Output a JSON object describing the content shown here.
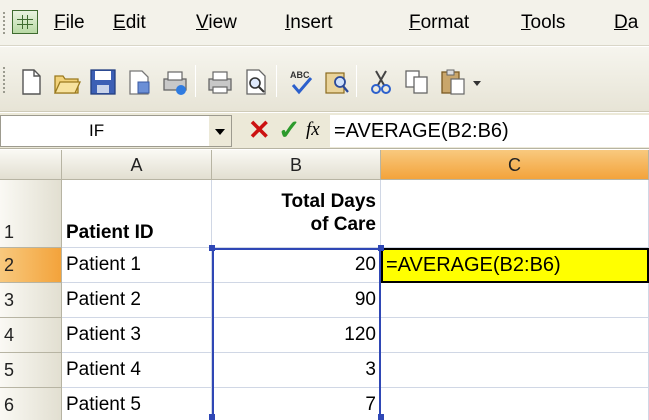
{
  "menubar": {
    "items": [
      "File",
      "Edit",
      "View",
      "Insert",
      "Format",
      "Tools",
      "Da"
    ]
  },
  "toolbar": {
    "buttons": [
      "new-icon",
      "open-icon",
      "save-icon",
      "permission-icon",
      "print-icon",
      "print-preview-icon",
      "spelling-icon",
      "research-icon",
      "cut-icon",
      "copy-icon",
      "paste-icon"
    ]
  },
  "formula_bar": {
    "name_box": "IF",
    "cancel_glyph": "✕",
    "enter_glyph": "✓",
    "fx_label": "fx",
    "formula": "=AVERAGE(B2:B6)"
  },
  "sheet": {
    "columns": [
      "A",
      "B",
      "C"
    ],
    "rows": [
      "1",
      "2",
      "3",
      "4",
      "5",
      "6"
    ],
    "header_row": {
      "a": "Patient ID",
      "b_line1": "Total Days",
      "b_line2": "of Care"
    },
    "data": [
      {
        "a": "Patient 1",
        "b": "20"
      },
      {
        "a": "Patient 2",
        "b": "90"
      },
      {
        "a": "Patient 3",
        "b": "120"
      },
      {
        "a": "Patient 4",
        "b": "3"
      },
      {
        "a": "Patient 5",
        "b": "7"
      }
    ],
    "editing_cell": {
      "ref": "C2",
      "text": "=AVERAGE(B2:B6)"
    }
  },
  "colors": {
    "active_header": "#f3a33b",
    "editing_fill": "#ffff00",
    "range_border": "#2f47b5"
  }
}
